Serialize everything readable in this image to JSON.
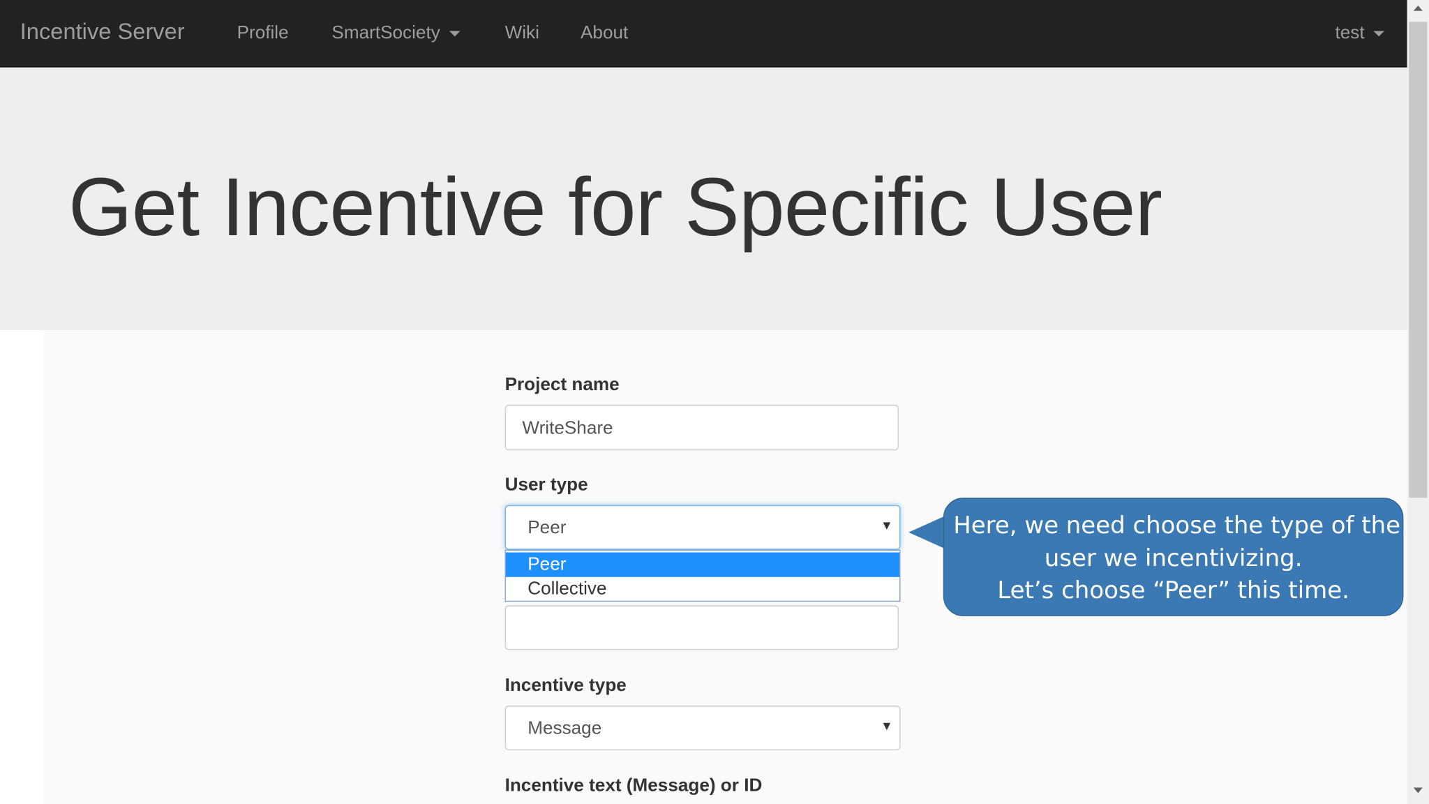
{
  "navbar": {
    "brand": "Incentive Server",
    "items": [
      {
        "label": "Profile"
      },
      {
        "label": "SmartSociety"
      },
      {
        "label": "Wiki"
      },
      {
        "label": "About"
      }
    ],
    "user": "test"
  },
  "page": {
    "title": "Get Incentive for Specific User"
  },
  "form": {
    "project_name_label": "Project name",
    "project_name_value": "WriteShare",
    "user_type_label": "User type",
    "user_type_value": "Peer",
    "user_type_options": [
      "Peer",
      "Collective"
    ],
    "user_id_value": "",
    "incentive_type_label": "Incentive type",
    "incentive_type_value": "Message",
    "incentive_text_label": "Incentive text (Message) or ID"
  },
  "callout": {
    "lines": [
      "Here, we need choose the type of the",
      "user we incentivizing.",
      "Let’s choose “Peer” this time."
    ]
  },
  "colors": {
    "navbar_bg": "#222222",
    "jumbotron_bg": "#eeeeee",
    "dropdown_selected": "#1e90ff",
    "callout_bg": "#3a79b3"
  }
}
